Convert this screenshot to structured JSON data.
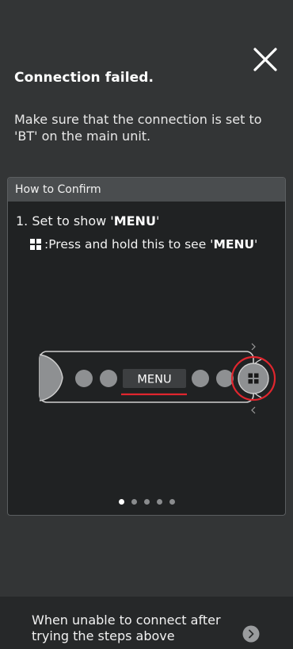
{
  "dialog": {
    "title": "Connection failed.",
    "description": "Make sure that the connection is set to 'BT' on the main unit."
  },
  "how_to_confirm": {
    "header": "How to Confirm",
    "step_prefix": "1. Set to show '",
    "step_highlight": "MENU",
    "step_suffix": "'",
    "hint_prefix": ":Press and hold this to see '",
    "hint_highlight": "MENU",
    "hint_suffix": "'",
    "device_display": "MENU",
    "pagination": {
      "total": 5,
      "active": 1
    }
  },
  "footer": {
    "text": "When unable to connect after trying the steps above"
  },
  "colors": {
    "background": "#333536",
    "panel": "#202223",
    "accent_red": "#e0262e"
  },
  "icons": {
    "close": "close-icon",
    "menu_button": "grid-icon",
    "footer_arrow": "chevron-right-icon"
  }
}
